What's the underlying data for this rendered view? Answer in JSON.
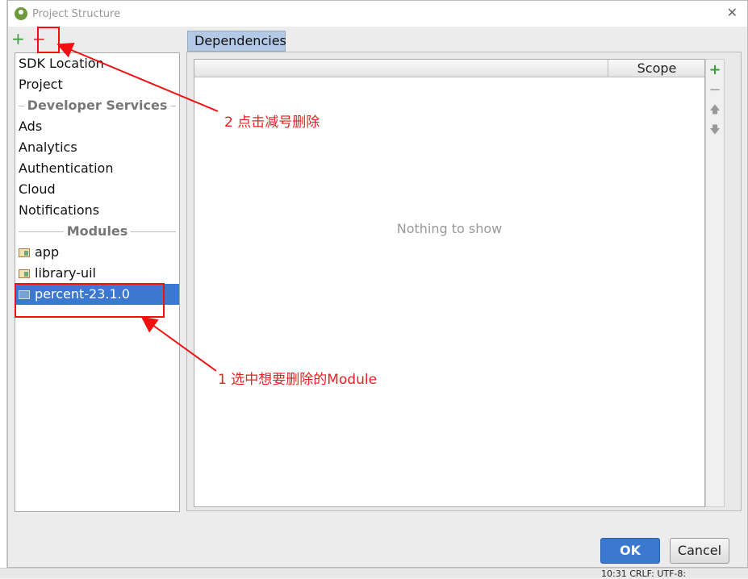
{
  "window": {
    "title": "Project Structure",
    "close_icon": "close-icon"
  },
  "toolbar": {
    "add": "+",
    "remove": "−"
  },
  "sidebar": {
    "items": [
      "SDK Location",
      "Project"
    ],
    "section_services": "Developer Services",
    "services": [
      "Ads",
      "Analytics",
      "Authentication",
      "Cloud",
      "Notifications"
    ],
    "section_modules": "Modules",
    "modules": [
      "app",
      "library-uil",
      "percent-23.1.0"
    ],
    "selected": "percent-23.1.0"
  },
  "main": {
    "tab": "Dependencies",
    "column_scope": "Scope",
    "empty": "Nothing to show"
  },
  "side_buttons": {
    "add": "+",
    "remove": "−",
    "up": "🡅",
    "down": "🡇"
  },
  "buttons": {
    "ok": "OK",
    "cancel": "Cancel"
  },
  "statusbar": {
    "text": "10:31  CRLF:  UTF-8:"
  },
  "annotations": {
    "step1": "1 选中想要删除的Module",
    "step2": "2 点击减号删除"
  },
  "colors": {
    "accent": "#3b78d0",
    "annotation": "#f01010"
  }
}
